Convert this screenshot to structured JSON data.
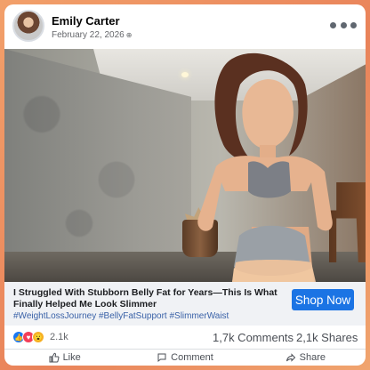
{
  "post": {
    "author": "Emily Carter",
    "date": "February 22, 2026",
    "headline": "I Struggled With Stubborn Belly Fat for Years—This Is What Finally Helped Me Look Slimmer",
    "hashtags": "#WeightLossJourney #BellyFatSupport #SlimmerWaist",
    "cta_label": "Shop Now"
  },
  "stats": {
    "reactions": "2.1k",
    "comments": "1,7k Comments",
    "shares": "2,1k Shares"
  },
  "actions": {
    "like": "Like",
    "comment": "Comment",
    "share": "Share"
  },
  "icons": [
    "globe-icon",
    "more-icon",
    "like-icon",
    "comment-icon",
    "share-icon"
  ],
  "colors": {
    "accent": "#1b74e4",
    "hashtag": "#3a62a8",
    "background": "#e9835a"
  }
}
